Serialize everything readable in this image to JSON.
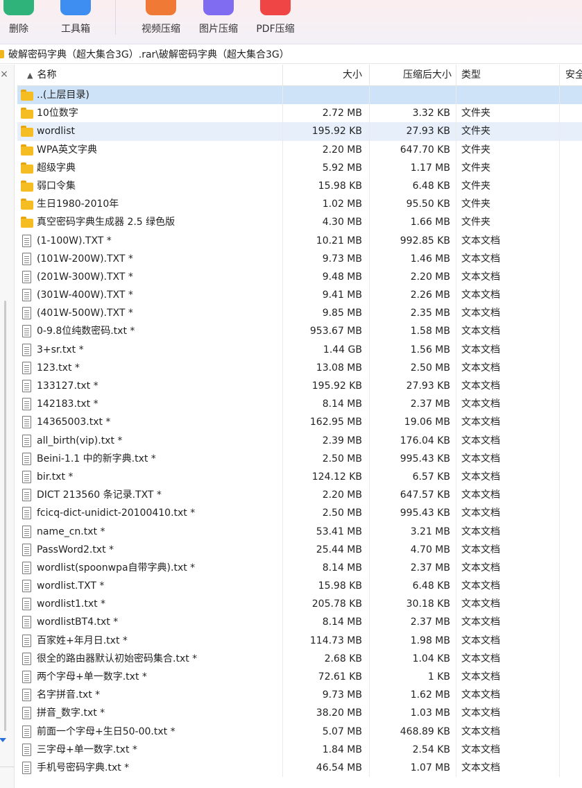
{
  "toolbar": {
    "buttons": [
      {
        "label": "删除",
        "icon": "delete-icon",
        "color": "#2fb37a"
      },
      {
        "label": "工具箱",
        "icon": "toolbox-icon",
        "color": "#3d8ef0"
      },
      {
        "label": "视频压缩",
        "icon": "video-compress-icon",
        "color": "#f07a35"
      },
      {
        "label": "图片压缩",
        "icon": "image-compress-icon",
        "color": "#7f6cf0"
      },
      {
        "label": "PDF压缩",
        "icon": "pdf-compress-icon",
        "color": "#f04545"
      }
    ]
  },
  "address": {
    "path": "破解密码字典（超大集合3G）.rar\\破解密码字典（超大集合3G）"
  },
  "left_pane": {
    "close_glyph": "×"
  },
  "columns": {
    "name": "名称",
    "size": "大小",
    "compressed_size": "压缩后大小",
    "type": "类型",
    "security": "安全"
  },
  "rows": [
    {
      "name": "..(上层目录)",
      "size": "",
      "csize": "",
      "type": "",
      "kind": "folder"
    },
    {
      "name": "10位数字",
      "size": "2.72 MB",
      "csize": "3.32 KB",
      "type": "文件夹",
      "kind": "folder"
    },
    {
      "name": "wordlist",
      "size": "195.92 KB",
      "csize": "27.93 KB",
      "type": "文件夹",
      "kind": "folder"
    },
    {
      "name": "WPA英文字典",
      "size": "2.20 MB",
      "csize": "647.70 KB",
      "type": "文件夹",
      "kind": "folder"
    },
    {
      "name": "超级字典",
      "size": "5.92 MB",
      "csize": "1.17 MB",
      "type": "文件夹",
      "kind": "folder"
    },
    {
      "name": "弱口令集",
      "size": "15.98 KB",
      "csize": "6.48 KB",
      "type": "文件夹",
      "kind": "folder"
    },
    {
      "name": "生日1980-2010年",
      "size": "1.02 MB",
      "csize": "95.50 KB",
      "type": "文件夹",
      "kind": "folder"
    },
    {
      "name": "真空密码字典生成器 2.5 绿色版",
      "size": "4.30 MB",
      "csize": "1.66 MB",
      "type": "文件夹",
      "kind": "folder"
    },
    {
      "name": "(1-100W).TXT *",
      "size": "10.21 MB",
      "csize": "992.85 KB",
      "type": "文本文档",
      "kind": "doc"
    },
    {
      "name": "(101W-200W).TXT *",
      "size": "9.73 MB",
      "csize": "1.46 MB",
      "type": "文本文档",
      "kind": "doc"
    },
    {
      "name": "(201W-300W).TXT *",
      "size": "9.48 MB",
      "csize": "2.20 MB",
      "type": "文本文档",
      "kind": "doc"
    },
    {
      "name": "(301W-400W).TXT *",
      "size": "9.41 MB",
      "csize": "2.26 MB",
      "type": "文本文档",
      "kind": "doc"
    },
    {
      "name": "(401W-500W).TXT *",
      "size": "9.85 MB",
      "csize": "2.35 MB",
      "type": "文本文档",
      "kind": "doc"
    },
    {
      "name": "0-9.8位纯数密码.txt *",
      "size": "953.67 MB",
      "csize": "1.58 MB",
      "type": "文本文档",
      "kind": "doc"
    },
    {
      "name": "3+sr.txt *",
      "size": "1.44 GB",
      "csize": "1.56 MB",
      "type": "文本文档",
      "kind": "doc"
    },
    {
      "name": "123.txt *",
      "size": "13.08 MB",
      "csize": "2.50 MB",
      "type": "文本文档",
      "kind": "doc"
    },
    {
      "name": "133127.txt *",
      "size": "195.92 KB",
      "csize": "27.93 KB",
      "type": "文本文档",
      "kind": "doc"
    },
    {
      "name": "142183.txt *",
      "size": "8.14 MB",
      "csize": "2.37 MB",
      "type": "文本文档",
      "kind": "doc"
    },
    {
      "name": "14365003.txt *",
      "size": "162.95 MB",
      "csize": "19.06 MB",
      "type": "文本文档",
      "kind": "doc"
    },
    {
      "name": "all_birth(vip).txt *",
      "size": "2.39 MB",
      "csize": "176.04 KB",
      "type": "文本文档",
      "kind": "doc"
    },
    {
      "name": "Beini-1.1 中的新字典.txt *",
      "size": "2.50 MB",
      "csize": "995.43 KB",
      "type": "文本文档",
      "kind": "doc"
    },
    {
      "name": "bir.txt *",
      "size": "124.12 KB",
      "csize": "6.57 KB",
      "type": "文本文档",
      "kind": "doc"
    },
    {
      "name": "DICT 213560 条记录.TXT *",
      "size": "2.20 MB",
      "csize": "647.57 KB",
      "type": "文本文档",
      "kind": "doc"
    },
    {
      "name": "fcicq-dict-unidict-20100410.txt *",
      "size": "2.50 MB",
      "csize": "995.43 KB",
      "type": "文本文档",
      "kind": "doc"
    },
    {
      "name": "name_cn.txt *",
      "size": "53.41 MB",
      "csize": "3.21 MB",
      "type": "文本文档",
      "kind": "doc"
    },
    {
      "name": "PassWord2.txt *",
      "size": "25.44 MB",
      "csize": "4.70 MB",
      "type": "文本文档",
      "kind": "doc"
    },
    {
      "name": "wordlist(spoonwpa自带字典).txt *",
      "size": "8.14 MB",
      "csize": "2.37 MB",
      "type": "文本文档",
      "kind": "doc"
    },
    {
      "name": "wordlist.TXT *",
      "size": "15.98 KB",
      "csize": "6.48 KB",
      "type": "文本文档",
      "kind": "doc"
    },
    {
      "name": "wordlist1.txt *",
      "size": "205.78 KB",
      "csize": "30.18 KB",
      "type": "文本文档",
      "kind": "doc"
    },
    {
      "name": "wordlistBT4.txt *",
      "size": "8.14 MB",
      "csize": "2.37 MB",
      "type": "文本文档",
      "kind": "doc"
    },
    {
      "name": "百家姓+年月日.txt *",
      "size": "114.73 MB",
      "csize": "1.98 MB",
      "type": "文本文档",
      "kind": "doc"
    },
    {
      "name": "很全的路由器默认初始密码集合.txt *",
      "size": "2.68 KB",
      "csize": "1.04 KB",
      "type": "文本文档",
      "kind": "doc"
    },
    {
      "name": "两个字母+单一数字.txt *",
      "size": "72.61 KB",
      "csize": "1 KB",
      "type": "文本文档",
      "kind": "doc"
    },
    {
      "name": "名字拼音.txt *",
      "size": "9.73 MB",
      "csize": "1.62 MB",
      "type": "文本文档",
      "kind": "doc"
    },
    {
      "name": "拼音_数字.txt *",
      "size": "38.20 MB",
      "csize": "1.03 MB",
      "type": "文本文档",
      "kind": "doc"
    },
    {
      "name": "前面一个字母+生日50-00.txt *",
      "size": "5.07 MB",
      "csize": "468.89 KB",
      "type": "文本文档",
      "kind": "doc"
    },
    {
      "name": "三字母+单一数字.txt *",
      "size": "1.84 MB",
      "csize": "2.54 KB",
      "type": "文本文档",
      "kind": "doc"
    },
    {
      "name": "手机号密码字典.txt *",
      "size": "46.54 MB",
      "csize": "1.07 MB",
      "type": "文本文档",
      "kind": "doc"
    }
  ]
}
